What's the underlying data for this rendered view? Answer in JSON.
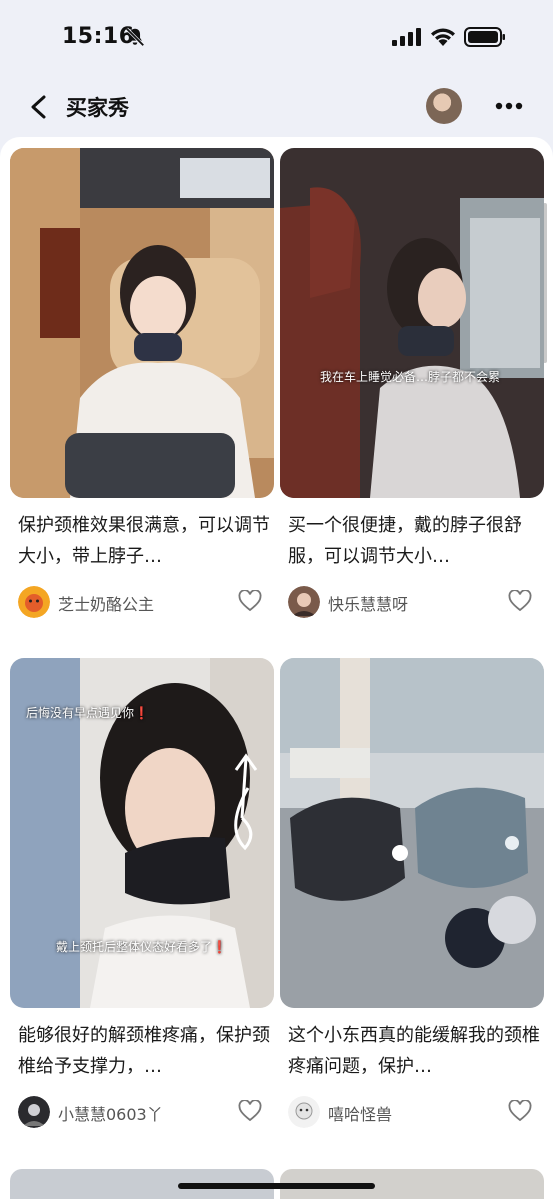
{
  "status_bar": {
    "time": "15:16"
  },
  "header": {
    "title": "买家秀"
  },
  "posts": [
    {
      "description": "保护颈椎效果很满意，可以调节大小，带上脖子…",
      "user": "芝士奶酪公主",
      "overlay": ""
    },
    {
      "description": "买一个很便捷，戴的脖子很舒服，可以调节大小…",
      "user": "快乐慧慧呀",
      "overlay": "我在车上睡觉必备…脖子都不会累"
    },
    {
      "description": "能够很好的解颈椎疼痛，保护颈椎给予支撑力，…",
      "user": "小慧慧0603丫",
      "overlay_top": "后悔没有早点遇见你❗",
      "overlay_bottom": "戴上颈托后整体仪态好看多了❗"
    },
    {
      "description": "这个小东西真的能缓解我的颈椎疼痛问题，保护…",
      "user": "嘻哈怪兽",
      "overlay": ""
    }
  ],
  "colors": {
    "background": "#eef0f7",
    "panel": "#ffffff",
    "text": "#1a1a1a",
    "username": "#555555"
  }
}
